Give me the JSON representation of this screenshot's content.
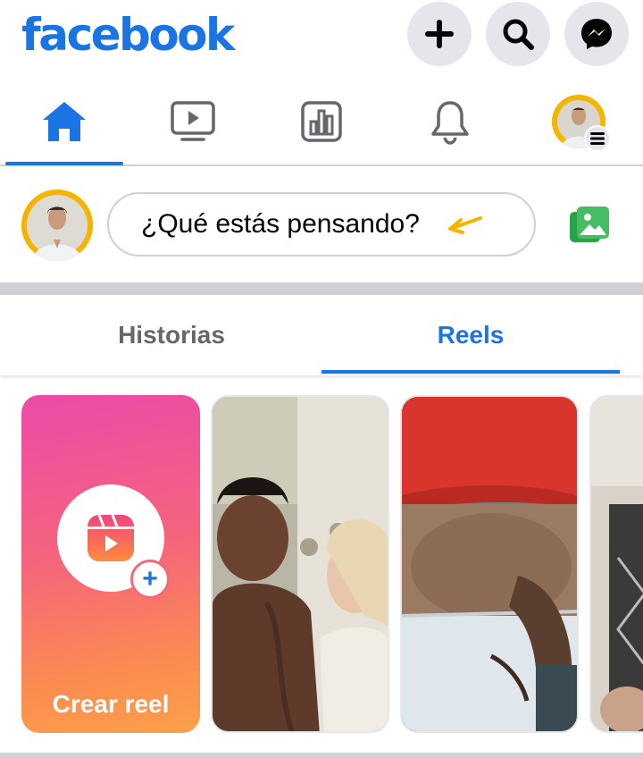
{
  "app": {
    "logo_text": "facebook",
    "brand_color": "#1b74e4"
  },
  "header": {
    "buttons": [
      {
        "name": "create",
        "icon": "plus-icon"
      },
      {
        "name": "search",
        "icon": "search-icon"
      },
      {
        "name": "messenger",
        "icon": "messenger-icon"
      }
    ]
  },
  "nav": {
    "items": [
      {
        "name": "home",
        "icon": "home-icon",
        "active": true
      },
      {
        "name": "watch",
        "icon": "video-icon",
        "active": false
      },
      {
        "name": "dashboard",
        "icon": "chart-icon",
        "active": false
      },
      {
        "name": "notifications",
        "icon": "bell-icon",
        "active": false
      },
      {
        "name": "menu",
        "icon": "profile-menu-icon",
        "active": false
      }
    ]
  },
  "composer": {
    "placeholder": "¿Qué estás pensando?",
    "photo_icon": "photo-icon"
  },
  "tabs": {
    "items": [
      {
        "label": "Historias",
        "active": false
      },
      {
        "label": "Reels",
        "active": true
      }
    ]
  },
  "reels": {
    "create_label": "Crear reel",
    "cards": [
      {
        "kind": "create"
      },
      {
        "kind": "video"
      },
      {
        "kind": "video"
      },
      {
        "kind": "video"
      }
    ]
  }
}
